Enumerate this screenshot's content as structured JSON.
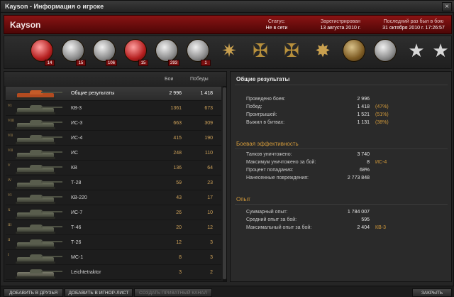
{
  "window": {
    "title": "Kayson - Информация о игроке",
    "close_glyph": "×"
  },
  "header": {
    "player_name": "Kayson",
    "status_label": "Статус:",
    "status_value": "Не в сети",
    "registered_label": "Зарегистрирован",
    "registered_value": "13 августа 2010 г.",
    "last_battle_label": "Последний раз был в бою",
    "last_battle_value": "31 октября 2010 г. 17:26:57"
  },
  "medals": [
    {
      "icon": "tank-medal",
      "count": "14"
    },
    {
      "icon": "tank-medal",
      "count": "15"
    },
    {
      "icon": "laurel-medal",
      "count": "106"
    },
    {
      "icon": "shield-medal",
      "count": "15"
    },
    {
      "icon": "tank-badge",
      "count": "293"
    },
    {
      "icon": "tank-badge",
      "count": "1"
    },
    {
      "icon": "order-star"
    },
    {
      "icon": "cross-order"
    },
    {
      "icon": "cross-order"
    },
    {
      "icon": "star-order"
    },
    {
      "icon": "portrait-medal"
    },
    {
      "icon": "portrait-medal"
    },
    {
      "icon": "silver-star"
    },
    {
      "icon": "silver-star"
    }
  ],
  "table": {
    "col_battles": "Бои",
    "col_wins": "Победы",
    "rows": [
      {
        "tier": "",
        "name": "Общие результаты",
        "battles": "2 996",
        "wins": "1 418"
      },
      {
        "tier": "VI",
        "name": "КВ-3",
        "battles": "1361",
        "wins": "673"
      },
      {
        "tier": "VIII",
        "name": "ИС-3",
        "battles": "663",
        "wins": "309"
      },
      {
        "tier": "VII",
        "name": "ИС-4",
        "battles": "415",
        "wins": "190"
      },
      {
        "tier": "VII",
        "name": "ИС",
        "battles": "248",
        "wins": "110"
      },
      {
        "tier": "V",
        "name": "КВ",
        "battles": "136",
        "wins": "64"
      },
      {
        "tier": "IV",
        "name": "Т-28",
        "battles": "59",
        "wins": "23"
      },
      {
        "tier": "VI",
        "name": "КВ-220",
        "battles": "43",
        "wins": "17"
      },
      {
        "tier": "X",
        "name": "ИС-7",
        "battles": "26",
        "wins": "10"
      },
      {
        "tier": "III",
        "name": "Т-46",
        "battles": "20",
        "wins": "12"
      },
      {
        "tier": "II",
        "name": "Т-26",
        "battles": "12",
        "wins": "3"
      },
      {
        "tier": "I",
        "name": "МС-1",
        "battles": "8",
        "wins": "3"
      },
      {
        "tier": "",
        "name": "Leichtetraktor",
        "battles": "3",
        "wins": "2"
      }
    ]
  },
  "summary": {
    "title": "Общие результаты",
    "general": [
      {
        "label": "Проведено боев:",
        "value": "2 996",
        "pct": ""
      },
      {
        "label": "Побед:",
        "value": "1 418",
        "pct": "(47%)"
      },
      {
        "label": "Проигрышей:",
        "value": "1 521",
        "pct": "(51%)"
      },
      {
        "label": "Выжил в битвах:",
        "value": "1 131",
        "pct": "(38%)"
      }
    ],
    "efficiency_title": "Боевая эффективность",
    "efficiency": [
      {
        "label": "Танков уничтожено:",
        "value": "3 740",
        "pct": ""
      },
      {
        "label": "Максимум уничтожено за бой:",
        "value": "8",
        "pct": "ИС-4"
      },
      {
        "label": "Процент попадания:",
        "value": "68%",
        "pct": ""
      },
      {
        "label": "Нанесенные повреждения:",
        "value": "2 773 848",
        "pct": ""
      }
    ],
    "experience_title": "Опыт",
    "experience": [
      {
        "label": "Суммарный опыт:",
        "value": "1 784 007",
        "pct": ""
      },
      {
        "label": "Средний опыт за бой:",
        "value": "595",
        "pct": ""
      },
      {
        "label": "Максимальный опыт за бой:",
        "value": "2 404",
        "pct": "КВ-3"
      }
    ]
  },
  "buttons": {
    "add_friend": "ДОБАВИТЬ В ДРУЗЬЯ",
    "add_ignore": "ДОБАВИТЬ В ИГНОР-ЛИСТ",
    "private_channel": "СОЗДАТЬ ПРИВАТНЫЙ КАНАЛ",
    "close": "ЗАКРЫТЬ"
  }
}
